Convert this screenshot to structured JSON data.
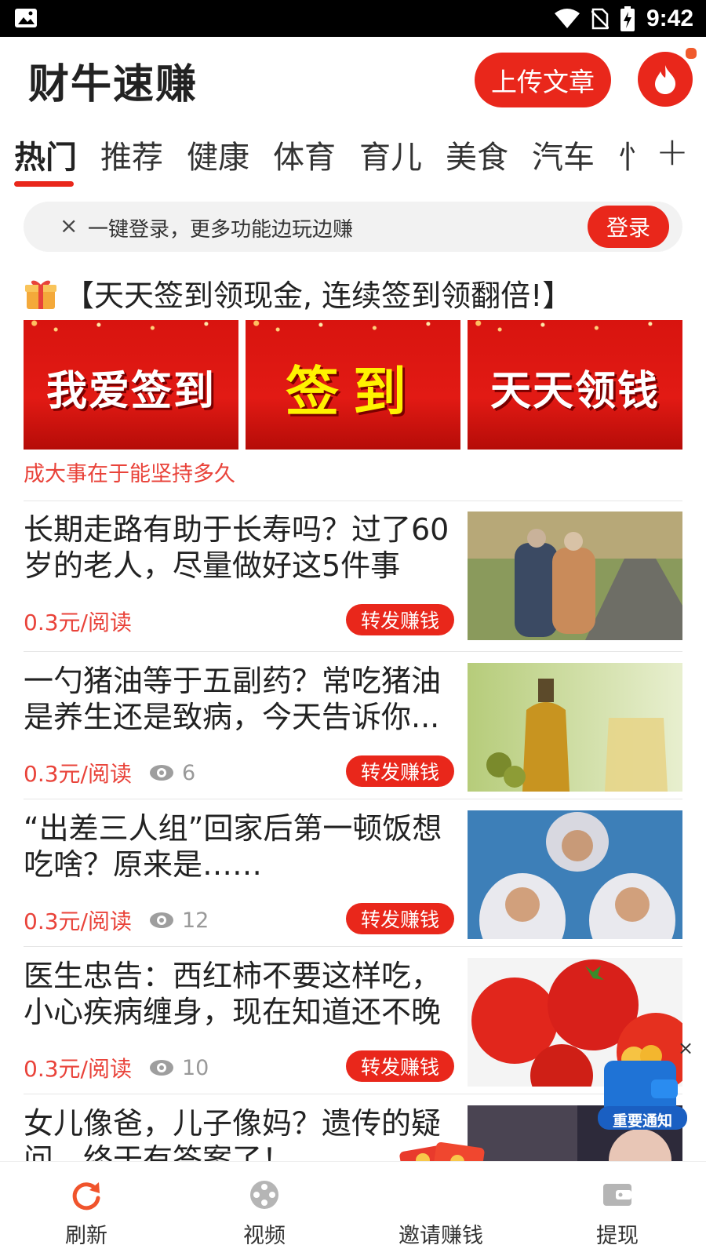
{
  "status_bar": {
    "time": "9:42"
  },
  "header": {
    "app_title": "财牛速赚",
    "upload_label": "上传文章"
  },
  "tabs": [
    {
      "label": "热门",
      "active": true
    },
    {
      "label": "推荐"
    },
    {
      "label": "健康"
    },
    {
      "label": "体育"
    },
    {
      "label": "育儿"
    },
    {
      "label": "美食"
    },
    {
      "label": "汽车"
    },
    {
      "label": "忄"
    }
  ],
  "tab_plus": "+",
  "login_prompt": {
    "close": "×",
    "text": "一键登录，更多功能边玩边赚",
    "button": "登录"
  },
  "promo": {
    "title": "【天天签到领现金, 连续签到领翻倍!】",
    "banners": [
      "我爱签到",
      "签到",
      "天天领钱"
    ],
    "subtitle": "成大事在于能坚持多久"
  },
  "articles": [
    {
      "title": "长期走路有助于长寿吗？过了60岁的老人，尽量做好这5件事",
      "price": "0.3元/阅读",
      "views": "",
      "share": "转发赚钱"
    },
    {
      "title": "一勺猪油等于五副药？常吃猪油是养生还是致病，今天告诉你...",
      "price": "0.3元/阅读",
      "views": "6",
      "share": "转发赚钱"
    },
    {
      "title": "“出差三人组”回家后第一顿饭想吃啥？原来是……",
      "price": "0.3元/阅读",
      "views": "12",
      "share": "转发赚钱"
    },
    {
      "title": "医生忠告：西红柿不要这样吃，小心疾病缠身，现在知道还不晚",
      "price": "0.3元/阅读",
      "views": "10",
      "share": "转发赚钱"
    },
    {
      "title": "女儿像爸，儿子像妈？遗传的疑问，终于有答案了！",
      "price": "",
      "views": "",
      "share": ""
    }
  ],
  "floating_notice": {
    "label": "重要通知",
    "close": "×"
  },
  "bottom_nav": [
    {
      "label": "刷新",
      "icon": "refresh-icon"
    },
    {
      "label": "视频",
      "icon": "film-reel-icon"
    },
    {
      "label": "邀请赚钱",
      "icon": "red-packet-icon"
    },
    {
      "label": "提现",
      "icon": "wallet-icon"
    }
  ],
  "colors": {
    "accent": "#e9271b",
    "price": "#e9433a"
  }
}
